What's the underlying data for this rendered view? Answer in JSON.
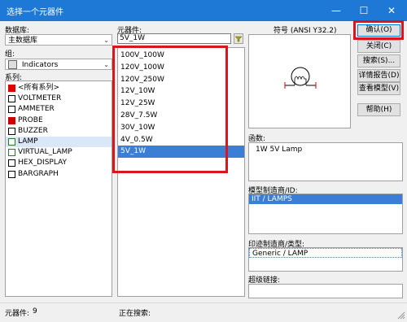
{
  "window": {
    "title": "选择一个元器件",
    "minimize": "—",
    "maximize": "☐",
    "close": "✕"
  },
  "left": {
    "database_label": "数据库:",
    "database_value": "主数据库",
    "group_label": "组:",
    "group_value": "Indicators",
    "series_label": "系列:",
    "series": [
      {
        "label": "<所有系列>",
        "icon": "all-series-icon",
        "color": "#e00000"
      },
      {
        "label": "VOLTMETER",
        "icon": "voltmeter-icon",
        "color": "#000000"
      },
      {
        "label": "AMMETER",
        "icon": "ammeter-icon",
        "color": "#000000"
      },
      {
        "label": "PROBE",
        "icon": "probe-icon",
        "color": "#cc0000"
      },
      {
        "label": "BUZZER",
        "icon": "buzzer-icon",
        "color": "#000000"
      },
      {
        "label": "LAMP",
        "icon": "lamp-icon",
        "color": "#2a7a2a"
      },
      {
        "label": "VIRTUAL_LAMP",
        "icon": "virtual-lamp-icon",
        "color": "#2a7a2a"
      },
      {
        "label": "HEX_DISPLAY",
        "icon": "hex-display-icon",
        "color": "#000000"
      },
      {
        "label": "BARGRAPH",
        "icon": "bargraph-icon",
        "color": "#000000"
      }
    ]
  },
  "middle": {
    "component_label": "元器件:",
    "search_value": "5V_1W",
    "components": [
      "100V_100W",
      "120V_100W",
      "120V_250W",
      "12V_10W",
      "12V_25W",
      "28V_7.5W",
      "30V_10W",
      "4V_0.5W",
      "5V_1W"
    ]
  },
  "symbol": {
    "label": "符号 (ANSI Y32.2)"
  },
  "right_info": {
    "function_label": "函数:",
    "function_value": "1W 5V Lamp",
    "model_mfr_label": "模型制造商/ID:",
    "model_mfr_value": "IIT / LAMPS",
    "footprint_label": "印迹制造商/类型:",
    "footprint_value": "Generic / LAMP",
    "hyperlink_label": "超级链接:"
  },
  "buttons": {
    "ok": "确认(O)",
    "close": "关闭(C)",
    "search": "搜索(S)...",
    "detail": "详情报告(D)",
    "model": "查看模型(V)",
    "help": "帮助(H)"
  },
  "status": {
    "component_count_label": "元器件:",
    "component_count": "9",
    "searching_label": "正在搜索:"
  },
  "colors": {
    "titlebar": "#1e79d6",
    "selection": "#3a7ed6",
    "highlight_red": "#d9161e"
  }
}
